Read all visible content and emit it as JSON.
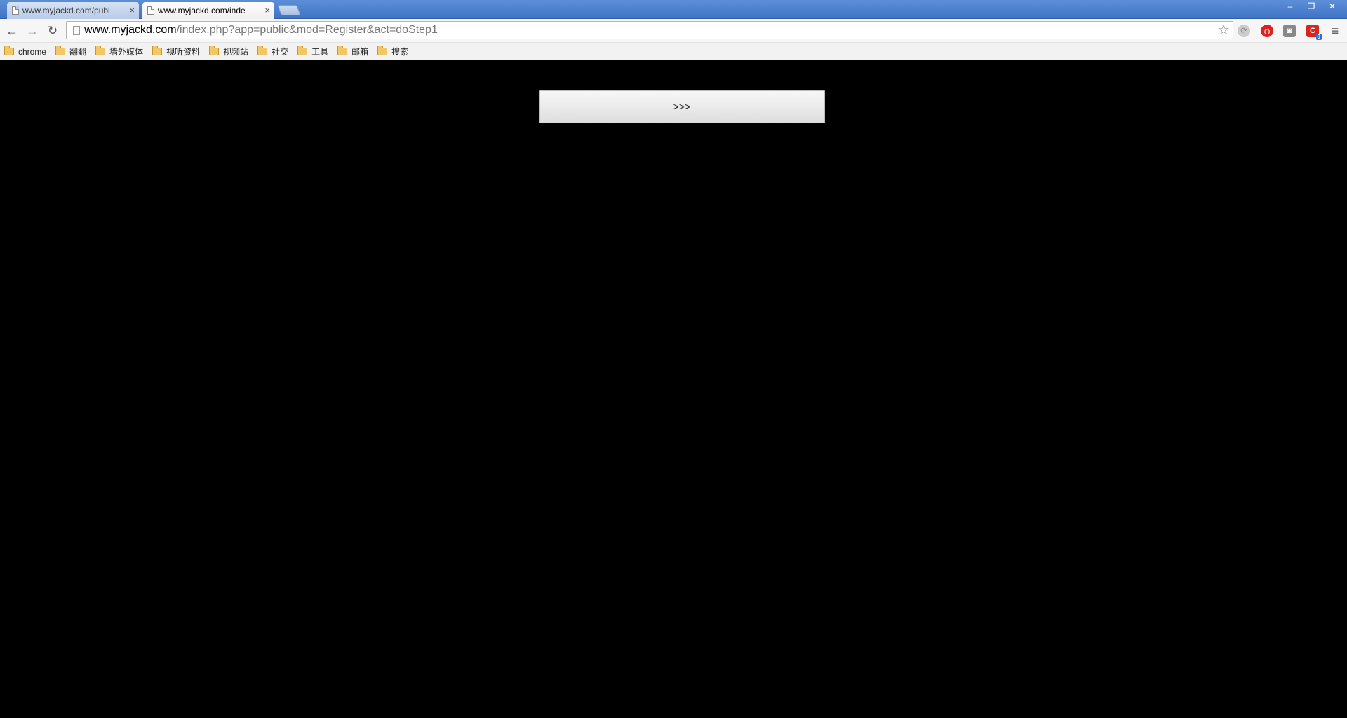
{
  "tabs": [
    {
      "title": "www.myjackd.com/publ",
      "close": "×",
      "active": false
    },
    {
      "title": "www.myjackd.com/inde",
      "close": "×",
      "active": true
    }
  ],
  "window_controls": {
    "minimize": "–",
    "restore": "❐",
    "close": "✕"
  },
  "toolbar": {
    "back": "←",
    "forward": "→",
    "reload": "↻",
    "url_host": "www.myjackd.com",
    "url_path": "/index.php?app=public&mod=Register&act=doStep1",
    "star": "☆",
    "menu": "≡",
    "extensions": [
      {
        "name": "sync-icon",
        "glyph": "⟳"
      },
      {
        "name": "opera-extension-icon",
        "glyph": "O"
      },
      {
        "name": "glasses-extension-icon",
        "glyph": "◙"
      },
      {
        "name": "c-extension-icon",
        "glyph": "C",
        "badge": "6"
      }
    ]
  },
  "bookmarks": [
    {
      "label": "chrome"
    },
    {
      "label": "翻翻"
    },
    {
      "label": "墙外媒体"
    },
    {
      "label": "视听资料"
    },
    {
      "label": "视频站"
    },
    {
      "label": "社交"
    },
    {
      "label": "工具"
    },
    {
      "label": "邮箱"
    },
    {
      "label": "搜索"
    }
  ],
  "content": {
    "next_button_label": ">>>",
    "background_color": "#000000"
  }
}
